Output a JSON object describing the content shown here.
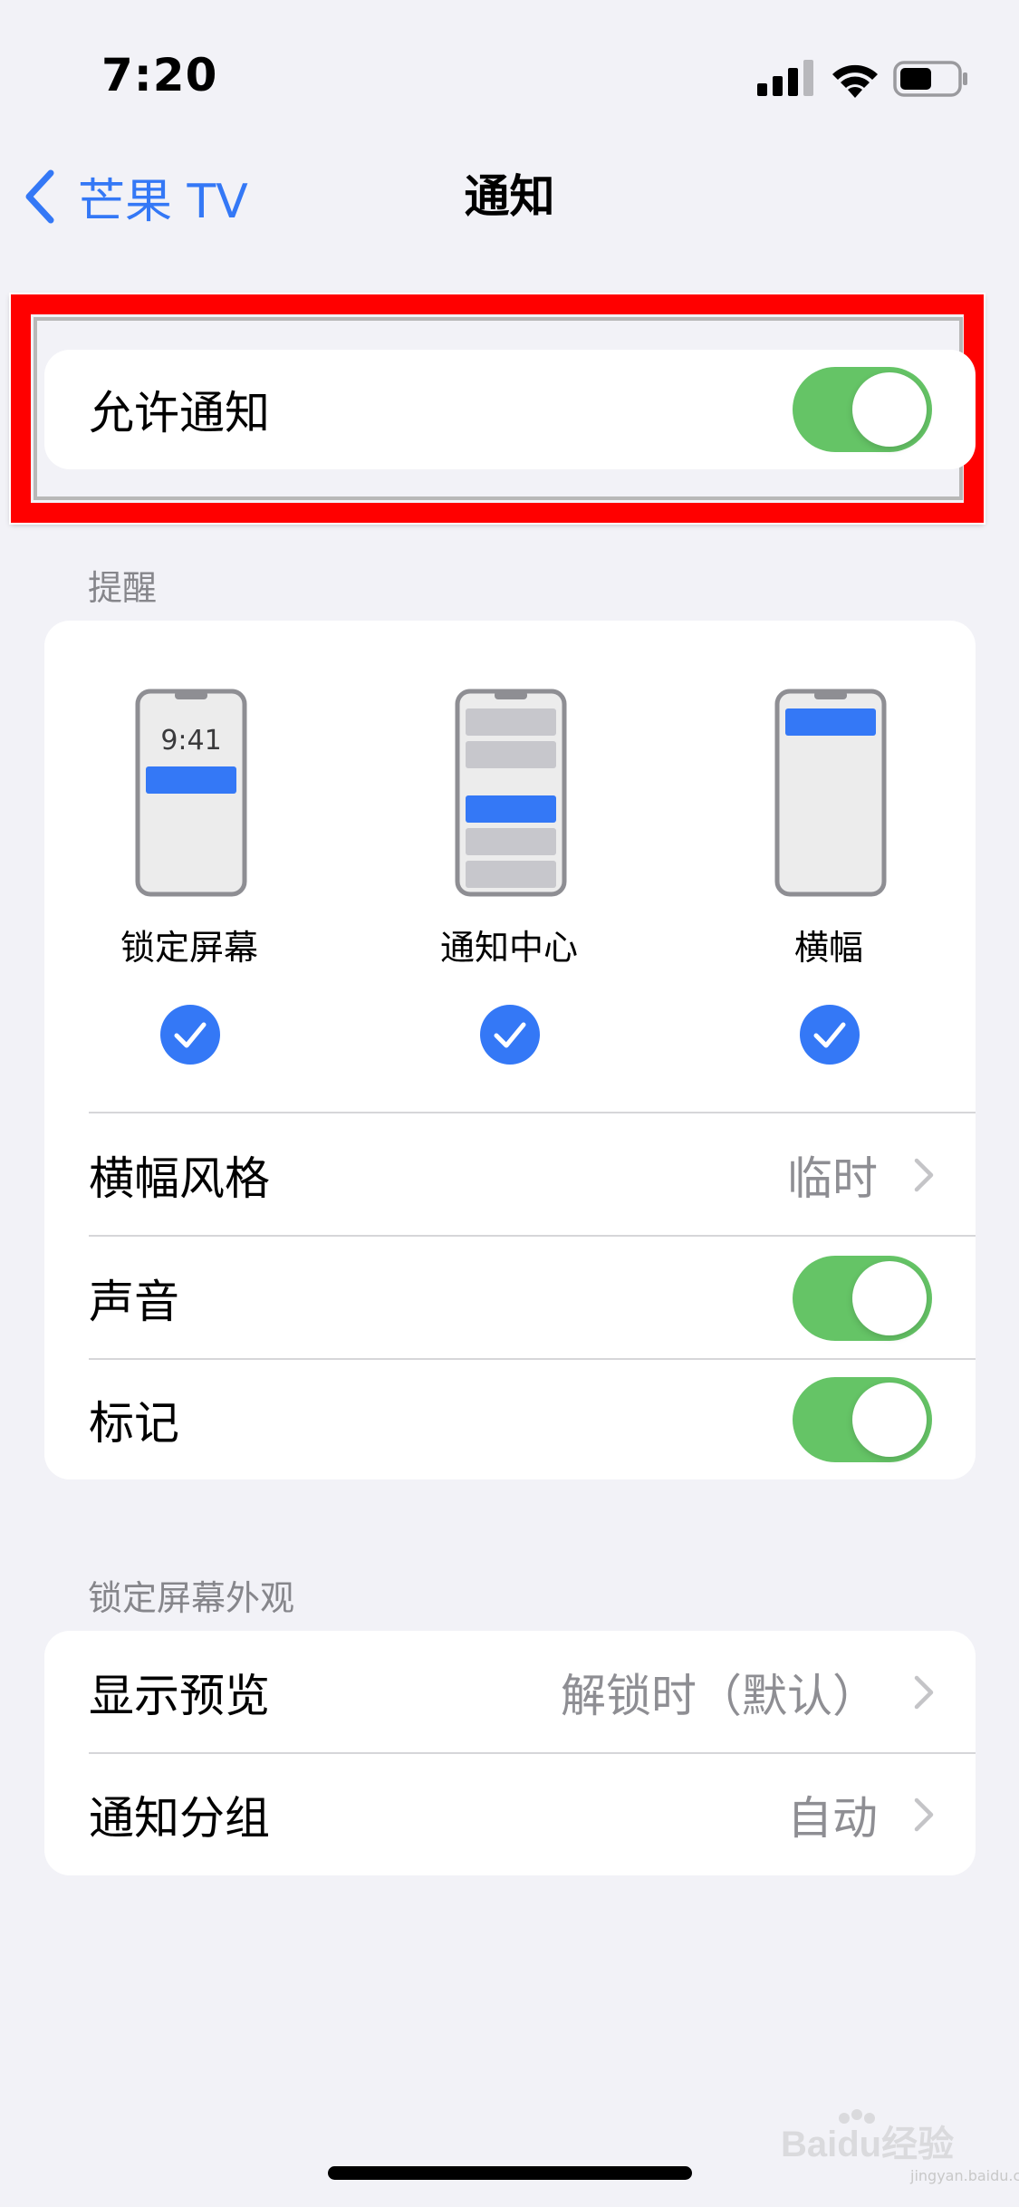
{
  "status_bar": {
    "time": "7:20"
  },
  "nav": {
    "back_label": "芒果 TV",
    "title": "通知"
  },
  "allow_notifications": {
    "label": "允许通知",
    "enabled": true
  },
  "alerts": {
    "header": "提醒",
    "options": [
      {
        "label": "锁定屏幕",
        "preview_time": "9:41",
        "checked": true
      },
      {
        "label": "通知中心",
        "checked": true
      },
      {
        "label": "横幅",
        "checked": true
      }
    ],
    "banner_style": {
      "label": "横幅风格",
      "value": "临时"
    },
    "sounds": {
      "label": "声音",
      "enabled": true
    },
    "badges": {
      "label": "标记",
      "enabled": true
    }
  },
  "lock_screen_appearance": {
    "header": "锁定屏幕外观",
    "show_previews": {
      "label": "显示预览",
      "value": "解锁时（默认）"
    },
    "notification_grouping": {
      "label": "通知分组",
      "value": "自动"
    }
  },
  "watermark": {
    "brand": "Baidu经验",
    "site": "jingyan.baidu.com"
  },
  "colors": {
    "accent": "#3478f6",
    "toggle_on": "#65c466",
    "background": "#f2f2f7",
    "highlight": "#ff0000",
    "secondary_text": "#8e8e93"
  }
}
